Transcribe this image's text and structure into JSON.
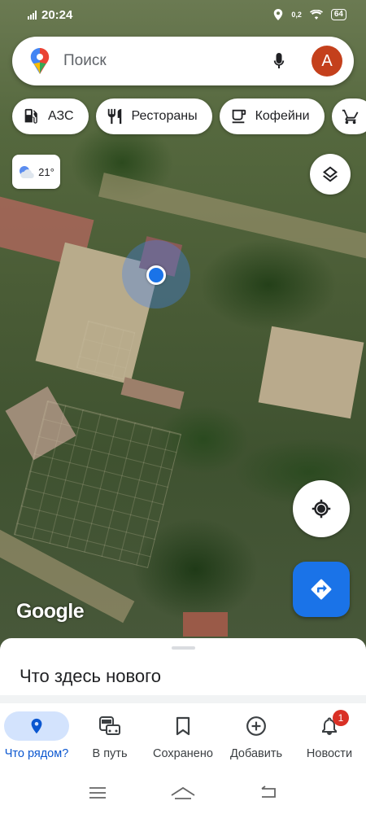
{
  "status_bar": {
    "time": "20:24",
    "data_speed": "0,2",
    "battery": "64"
  },
  "search": {
    "placeholder": "Поиск",
    "avatar_letter": "A"
  },
  "chips": [
    {
      "label": "АЗС",
      "icon": "gas-station-icon"
    },
    {
      "label": "Рестораны",
      "icon": "restaurant-icon"
    },
    {
      "label": "Кофейни",
      "icon": "coffee-icon"
    },
    {
      "label": "",
      "icon": "shopping-cart-icon"
    }
  ],
  "weather": {
    "temperature": "21°",
    "icon": "partly-cloudy-icon"
  },
  "map": {
    "attribution": "Google"
  },
  "sheet": {
    "title": "Что здесь нового"
  },
  "bottom_nav": [
    {
      "label": "Что рядом?",
      "icon": "location-pin-icon",
      "active": true
    },
    {
      "label": "В путь",
      "icon": "commute-icon"
    },
    {
      "label": "Сохранено",
      "icon": "bookmark-icon"
    },
    {
      "label": "Добавить",
      "icon": "add-circle-icon"
    },
    {
      "label": "Новости",
      "icon": "bell-icon",
      "badge": "1"
    }
  ],
  "colors": {
    "accent": "#1a73e8",
    "avatar": "#c4401c",
    "active_nav_bg": "#d3e3fd",
    "badge": "#d93025"
  }
}
